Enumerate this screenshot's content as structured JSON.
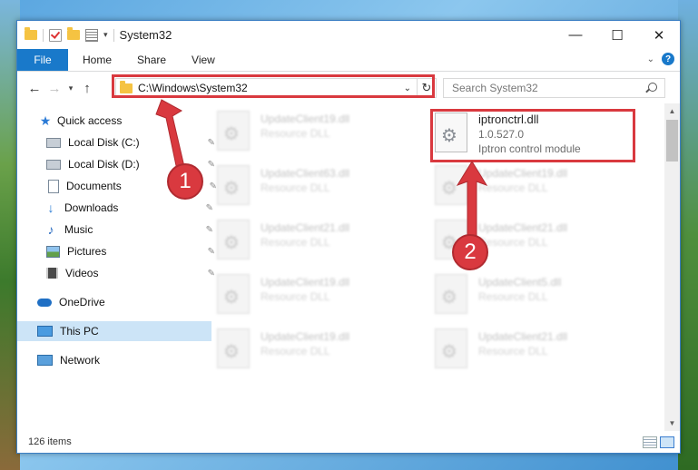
{
  "window": {
    "title": "System32",
    "controls": {
      "minimize": "—",
      "maximize": "☐",
      "close": "✕"
    }
  },
  "ribbon": {
    "tabs": [
      "File",
      "Home",
      "Share",
      "View"
    ],
    "help": "?"
  },
  "address": {
    "path": "C:\\Windows\\System32",
    "search_placeholder": "Search System32"
  },
  "nav": {
    "items": [
      {
        "label": "Quick access",
        "icon": "star-icon",
        "pinned": false
      },
      {
        "label": "Local Disk (C:)",
        "icon": "drive-icon",
        "pinned": true
      },
      {
        "label": "Local Disk (D:)",
        "icon": "drive-icon",
        "pinned": true
      },
      {
        "label": "Documents",
        "icon": "document-icon",
        "pinned": true
      },
      {
        "label": "Downloads",
        "icon": "download-icon",
        "pinned": true
      },
      {
        "label": "Music",
        "icon": "music-icon",
        "pinned": true
      },
      {
        "label": "Pictures",
        "icon": "pictures-icon",
        "pinned": true
      },
      {
        "label": "Videos",
        "icon": "video-icon",
        "pinned": true
      },
      {
        "label": "OneDrive",
        "icon": "cloud-icon",
        "pinned": false
      },
      {
        "label": "This PC",
        "icon": "computer-icon",
        "pinned": false,
        "selected": true
      },
      {
        "label": "Network",
        "icon": "network-icon",
        "pinned": false
      }
    ]
  },
  "files": {
    "left": [
      {
        "name": "UpdateClient19.dll",
        "desc": "Resource DLL"
      },
      {
        "name": "UpdateClient63.dll",
        "desc": "Resource DLL"
      },
      {
        "name": "UpdateClient21.dll",
        "desc": "Resource DLL"
      },
      {
        "name": "UpdateClient19.dll",
        "desc": "Resource DLL"
      },
      {
        "name": "UpdateClient19.dll",
        "desc": "Resource DLL"
      }
    ],
    "right": [
      {
        "name": "iptronctrl.dll",
        "version": "1.0.527.0",
        "desc": "Iptron control module"
      },
      {
        "name": "UpdateClient19.dll",
        "desc": "Resource DLL"
      },
      {
        "name": "UpdateClient21.dll",
        "desc": "Resource DLL"
      },
      {
        "name": "UpdateClient5.dll",
        "desc": "Resource DLL"
      },
      {
        "name": "UpdateClient21.dll",
        "desc": "Resource DLL"
      }
    ]
  },
  "status": {
    "item_count": "126 items"
  },
  "annotations": {
    "step1": "1",
    "step2": "2",
    "color": "#d9393f"
  }
}
